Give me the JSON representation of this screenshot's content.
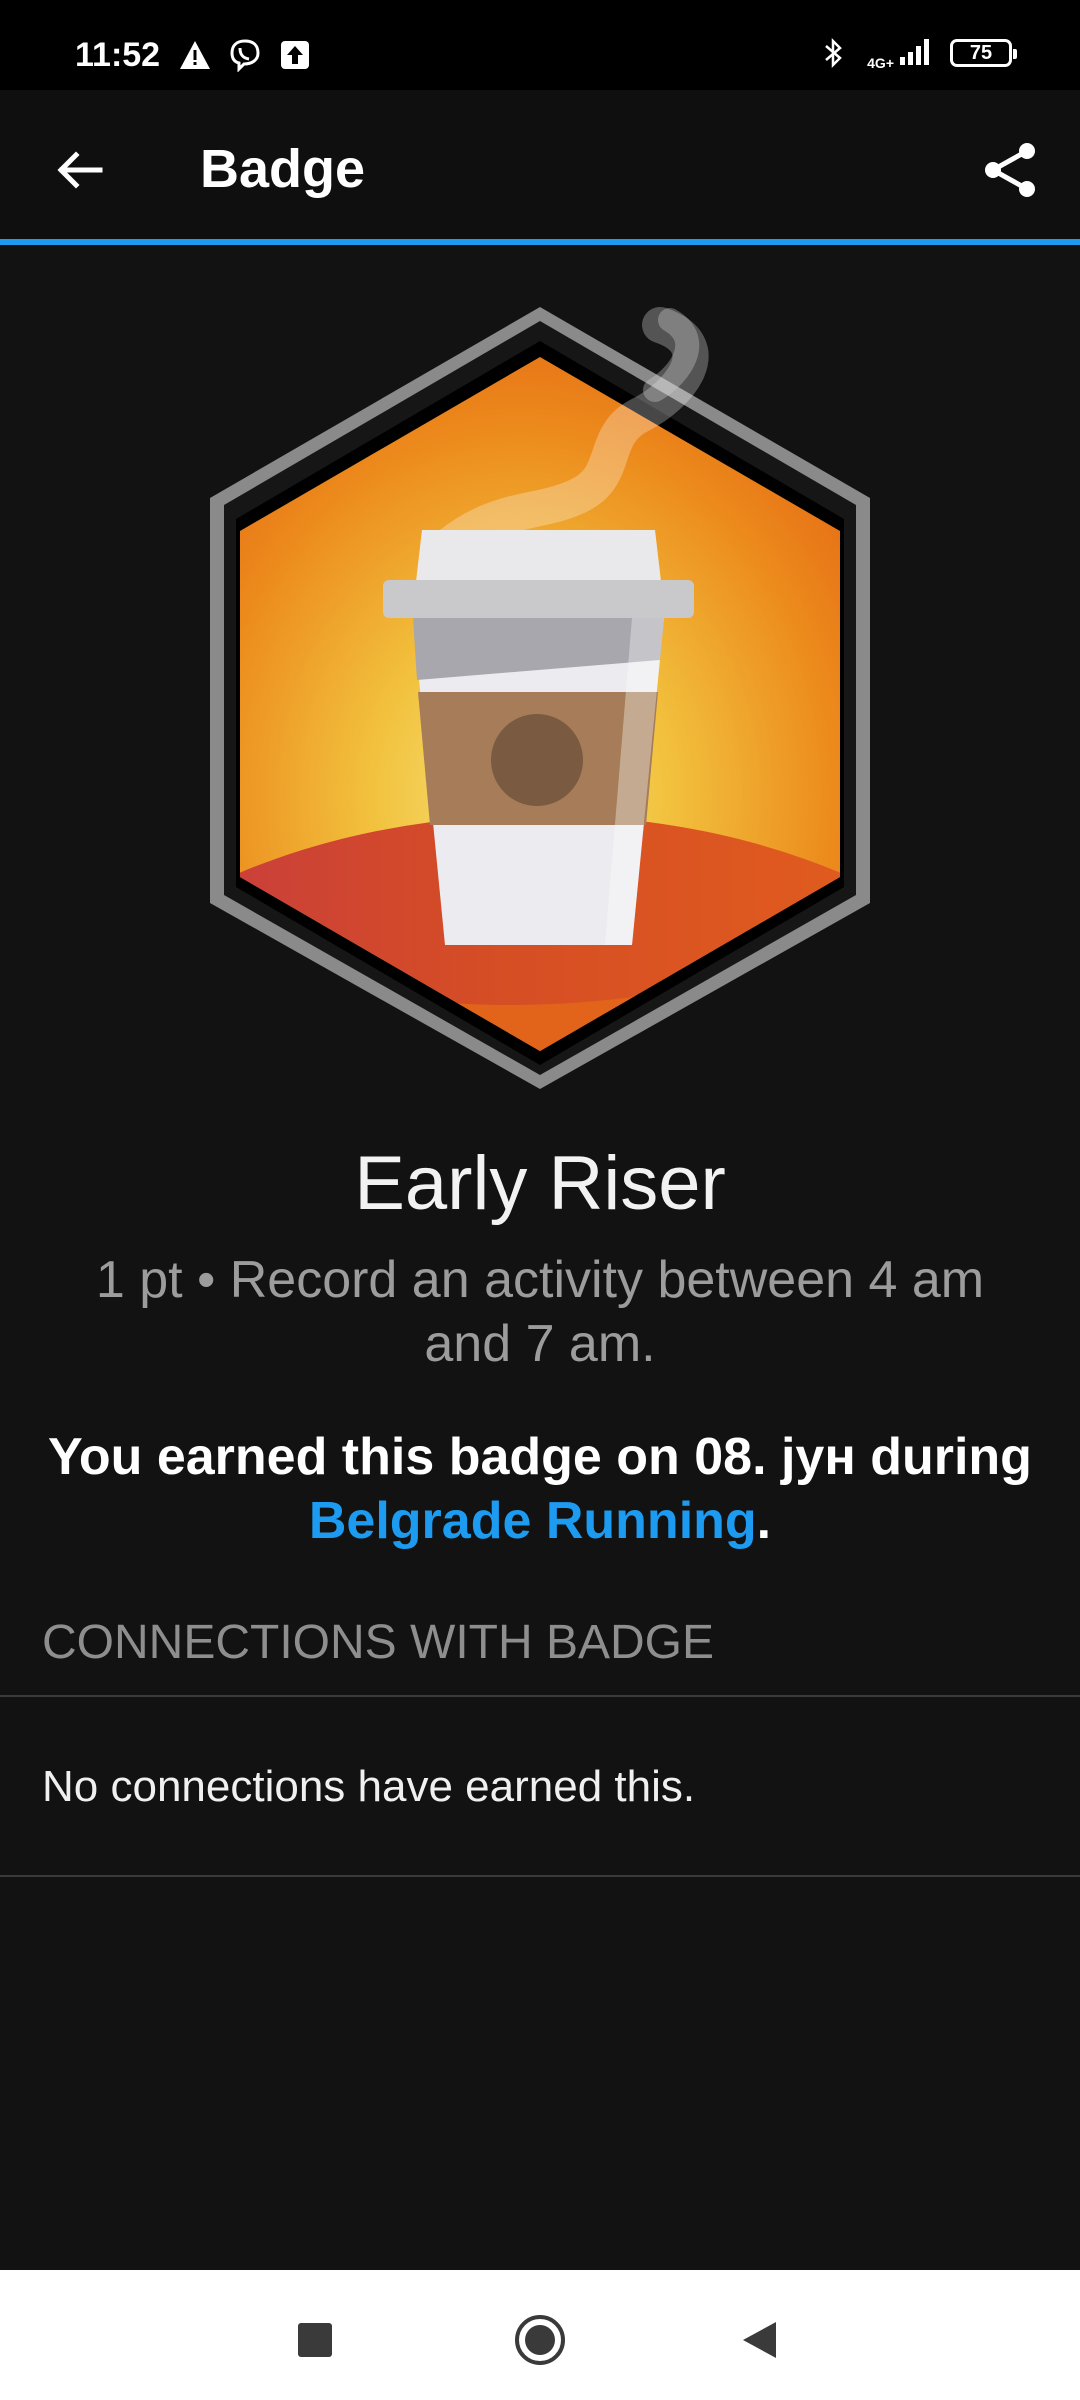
{
  "status_bar": {
    "time": "11:52",
    "network": "4G+",
    "battery": "75"
  },
  "app_bar": {
    "title": "Badge"
  },
  "badge": {
    "name": "Early Riser",
    "description": "1 pt • Record an activity between 4 am and 7 am.",
    "earned_prefix": "You earned this badge on 08. јун during ",
    "earned_link": "Belgrade Running",
    "earned_suffix": "."
  },
  "connections": {
    "section_title": "CONNECTIONS WITH BADGE",
    "empty_message": "No connections have earned this."
  },
  "colors": {
    "accent": "#1d9bf0",
    "background": "#121212",
    "badge_orange": "#ef7a1a"
  },
  "icons": {
    "back": "arrow-left-icon",
    "share": "share-icon",
    "nav_recents": "square-icon",
    "nav_home": "circle-icon",
    "nav_back": "triangle-back-icon"
  }
}
